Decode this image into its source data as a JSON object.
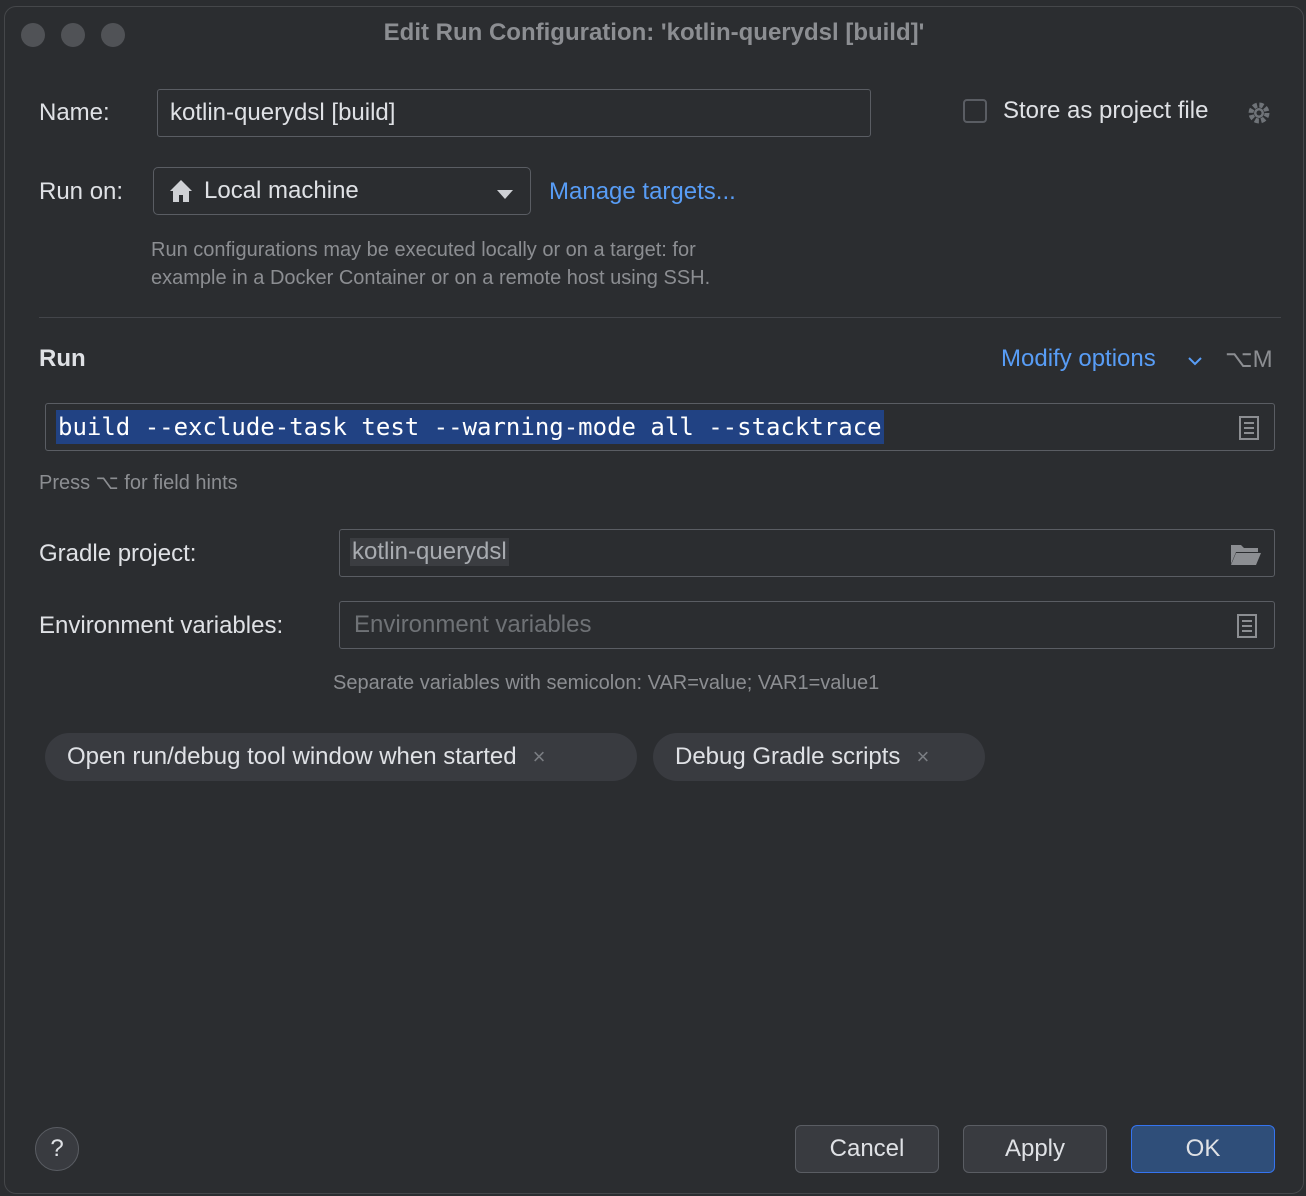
{
  "window": {
    "title": "Edit Run Configuration: 'kotlin-querydsl [build]'"
  },
  "name": {
    "label": "Name:",
    "value": "kotlin-querydsl [build]"
  },
  "store": {
    "label": "Store as project file",
    "checked": false,
    "icon": "gear-icon"
  },
  "run_on": {
    "label": "Run on:",
    "value": "Local machine",
    "icon": "home-icon",
    "manage_link": "Manage targets...",
    "hint_line1": "Run configurations may be executed locally or on a target: for",
    "hint_line2": "example in a Docker Container or on a remote host using SSH."
  },
  "run_section": {
    "heading": "Run",
    "modify_options": "Modify options",
    "shortcut": "⌥M",
    "command": "build --exclude-task test --warning-mode all --stacktrace",
    "field_hint": "Press ⌥ for field hints"
  },
  "gradle": {
    "label": "Gradle project:",
    "value": "kotlin-querydsl"
  },
  "env": {
    "label": "Environment variables:",
    "placeholder": "Environment variables",
    "hint": "Separate variables with semicolon: VAR=value; VAR1=value1"
  },
  "chips": [
    {
      "label": "Open run/debug tool window when started"
    },
    {
      "label": "Debug Gradle scripts"
    }
  ],
  "chip_close": "×",
  "buttons": {
    "help": "?",
    "cancel": "Cancel",
    "apply": "Apply",
    "ok": "OK"
  },
  "colors": {
    "accent": "#589df6",
    "selection": "#214283",
    "primary_button": "#2f4e79"
  }
}
